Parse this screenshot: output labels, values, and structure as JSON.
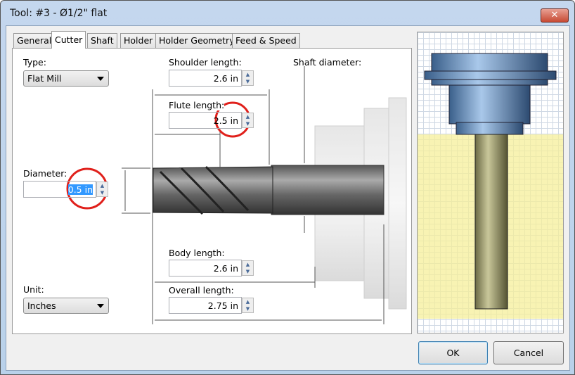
{
  "window": {
    "title": "Tool: #3 - Ø1/2\" flat",
    "close": "✕"
  },
  "tabs": [
    "General",
    "Cutter",
    "Shaft",
    "Holder",
    "Holder Geometry",
    "Feed & Speed"
  ],
  "fields": {
    "type_label": "Type:",
    "type_value": "Flat Mill",
    "shoulder_label": "Shoulder length:",
    "shoulder_value": "2.6 in",
    "shaft_diameter_label": "Shaft diameter:",
    "flute_label": "Flute length:",
    "flute_value": "2.5 in",
    "diameter_label": "Diameter:",
    "diameter_value": "0.5 in",
    "body_label": "Body length:",
    "body_value": "2.6 in",
    "overall_label": "Overall length:",
    "overall_value": "2.75 in",
    "unit_label": "Unit:",
    "unit_value": "Inches"
  },
  "buttons": {
    "ok": "OK",
    "cancel": "Cancel"
  },
  "colors": {
    "highlight": "#e0201b",
    "selection": "#3399ff"
  }
}
